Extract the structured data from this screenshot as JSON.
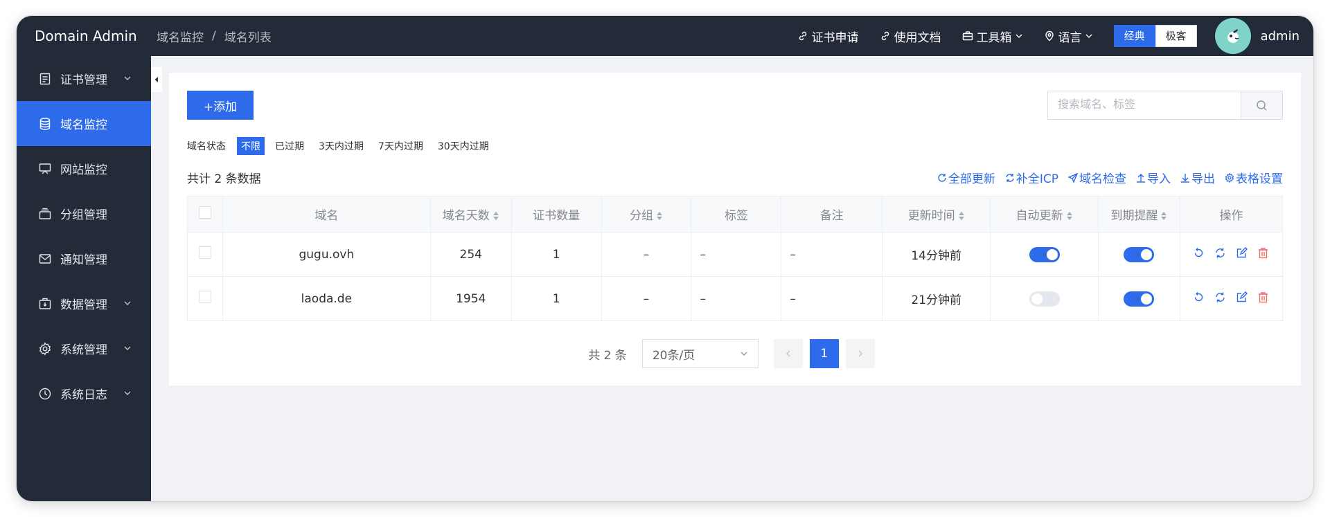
{
  "header": {
    "brand": "Domain Admin",
    "breadcrumb": [
      "域名监控",
      "域名列表"
    ],
    "breadcrumb_sep": "/",
    "links": [
      {
        "label": "证书申请",
        "icon": "link-icon"
      },
      {
        "label": "使用文档",
        "icon": "link-icon"
      },
      {
        "label": "工具箱",
        "icon": "toolbox-icon"
      },
      {
        "label": "语言",
        "icon": "location-icon"
      }
    ],
    "theme_options": [
      "经典",
      "极客"
    ],
    "theme_selected": "经典",
    "username": "admin"
  },
  "sidebar": {
    "items": [
      {
        "label": "证书管理",
        "icon": "document-icon",
        "expandable": true
      },
      {
        "label": "域名监控",
        "icon": "database-icon",
        "expandable": false,
        "active": true
      },
      {
        "label": "网站监控",
        "icon": "monitor-icon",
        "expandable": false
      },
      {
        "label": "分组管理",
        "icon": "folder-icon",
        "expandable": false
      },
      {
        "label": "通知管理",
        "icon": "mail-icon",
        "expandable": false
      },
      {
        "label": "数据管理",
        "icon": "box-icon",
        "expandable": true
      },
      {
        "label": "系统管理",
        "icon": "gear-icon",
        "expandable": true
      },
      {
        "label": "系统日志",
        "icon": "clock-icon",
        "expandable": true
      }
    ]
  },
  "toolbar": {
    "add_label": "+添加",
    "search_placeholder": "搜索域名、标签"
  },
  "filter": {
    "label": "域名状态",
    "options": [
      "不限",
      "已过期",
      "3天内过期",
      "7天内过期",
      "30天内过期"
    ],
    "selected": "不限"
  },
  "summary": "共计 2 条数据",
  "actions": [
    {
      "label": "全部更新",
      "icon": "refresh-icon"
    },
    {
      "label": "补全ICP",
      "icon": "sync-icon"
    },
    {
      "label": "域名检查",
      "icon": "send-icon"
    },
    {
      "label": "导入",
      "icon": "upload-icon"
    },
    {
      "label": "导出",
      "icon": "download-icon"
    },
    {
      "label": "表格设置",
      "icon": "gear-icon"
    }
  ],
  "table": {
    "columns": [
      "域名",
      "域名天数",
      "证书数量",
      "分组",
      "标签",
      "备注",
      "更新时间",
      "自动更新",
      "到期提醒",
      "操作"
    ],
    "rows": [
      {
        "domain": "gugu.ovh",
        "days": "254",
        "certs": "1",
        "group": "–",
        "tags": "–",
        "note": "–",
        "updated": "14分钟前",
        "auto_update": true,
        "expire_alert": true
      },
      {
        "domain": "laoda.de",
        "days": "1954",
        "certs": "1",
        "group": "–",
        "tags": "–",
        "note": "–",
        "updated": "21分钟前",
        "auto_update": false,
        "expire_alert": true
      }
    ]
  },
  "pagination": {
    "total": "共 2 条",
    "page_size": "20条/页",
    "current": "1"
  },
  "colors": {
    "primary": "#2d6bea",
    "header_bg": "#232a38",
    "days_green": "#67c23a",
    "danger": "#f56c6c"
  }
}
